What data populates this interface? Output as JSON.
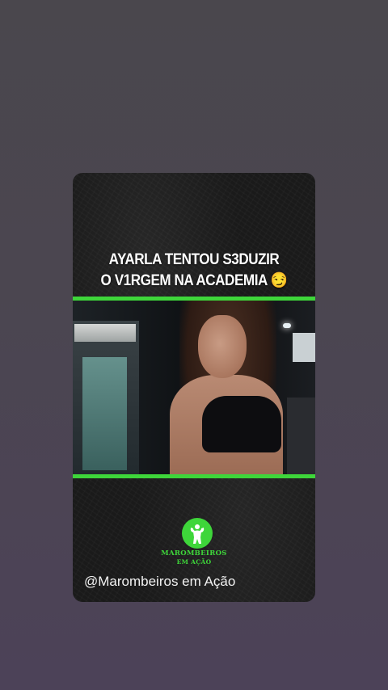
{
  "story": {
    "headline_line1": "AYARLA TENTOU S3DUZIR",
    "headline_line2": "O V1RGEM NA ACADEMIA 😏",
    "logo_line1": "MAROMBEIROS",
    "logo_line2": "EM AÇÃO",
    "handle": "@Marombeiros em Ação"
  },
  "colors": {
    "accent_green": "#3ed63a",
    "card_background": "#1a1a1a",
    "page_background": "#4b4650"
  },
  "icons": {
    "logo": "bodybuilder-icon"
  }
}
